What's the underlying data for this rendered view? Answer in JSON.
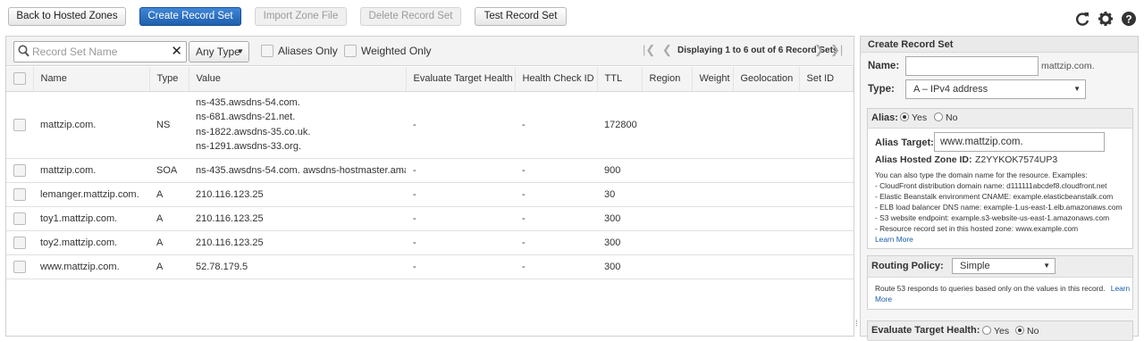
{
  "top_buttons": {
    "back": "Back to Hosted Zones",
    "create": "Create Record Set",
    "import": "Import Zone File",
    "delete": "Delete Record Set",
    "test": "Test Record Set"
  },
  "top_icons": [
    "refresh-icon",
    "gear-icon",
    "help-icon"
  ],
  "filter": {
    "search_placeholder": "Record Set Name",
    "type_select": "Any Type",
    "aliases_only": "Aliases Only",
    "weighted_only": "Weighted Only",
    "pager_text": "Displaying 1 to 6 out of 6 Record Sets"
  },
  "table": {
    "columns": [
      "Name",
      "Type",
      "Value",
      "Evaluate Target Health",
      "Health Check ID",
      "TTL",
      "Region",
      "Weight",
      "Geolocation",
      "Set ID"
    ],
    "rows": [
      {
        "name": "mattzip.com.",
        "type": "NS",
        "value": [
          "ns-435.awsdns-54.com.",
          "ns-681.awsdns-21.net.",
          "ns-1822.awsdns-35.co.uk.",
          "ns-1291.awsdns-33.org."
        ],
        "eval": "-",
        "hc": "-",
        "ttl": "172800"
      },
      {
        "name": "mattzip.com.",
        "type": "SOA",
        "value": [
          "ns-435.awsdns-54.com. awsdns-hostmaster.amazor"
        ],
        "eval": "-",
        "hc": "-",
        "ttl": "900"
      },
      {
        "name": "lemanger.mattzip.com.",
        "type": "A",
        "value": [
          "210.116.123.25"
        ],
        "eval": "-",
        "hc": "-",
        "ttl": "30"
      },
      {
        "name": "toy1.mattzip.com.",
        "type": "A",
        "value": [
          "210.116.123.25"
        ],
        "eval": "-",
        "hc": "-",
        "ttl": "300"
      },
      {
        "name": "toy2.mattzip.com.",
        "type": "A",
        "value": [
          "210.116.123.25"
        ],
        "eval": "-",
        "hc": "-",
        "ttl": "300"
      },
      {
        "name": "www.mattzip.com.",
        "type": "A",
        "value": [
          "52.78.179.5"
        ],
        "eval": "-",
        "hc": "-",
        "ttl": "300"
      }
    ]
  },
  "panel": {
    "title": "Create Record Set",
    "name_label": "Name:",
    "name_value": "",
    "name_suffix": "mattzip.com.",
    "type_label": "Type:",
    "type_value": "A – IPv4 address",
    "alias_label": "Alias:",
    "alias_yes": "Yes",
    "alias_no": "No",
    "alias_target_label": "Alias Target:",
    "alias_target_value": "www.mattzip.com.",
    "alias_zone_label": "Alias Hosted Zone ID:",
    "alias_zone_value": "Z2YYKOK7574UP3",
    "help_lines": [
      "You can also type the domain name for the resource. Examples:",
      "-  CloudFront distribution domain name: d111111abcdef8.cloudfront.net",
      "-  Elastic Beanstalk environment CNAME: example.elasticbeanstalk.com",
      "-  ELB load balancer DNS name: example-1.us-east-1.elb.amazonaws.com",
      "-  S3 website endpoint: example.s3-website-us-east-1.amazonaws.com",
      "-  Resource record set in this hosted zone: www.example.com"
    ],
    "learn_more": "Learn More",
    "routing_label": "Routing Policy:",
    "routing_value": "Simple",
    "routing_help": "Route 53 responds to queries based only on the values in this record.",
    "routing_learn": "Learn",
    "routing_more": "More",
    "eval_label": "Evaluate Target Health:",
    "eval_yes": "Yes",
    "eval_no": "No"
  }
}
